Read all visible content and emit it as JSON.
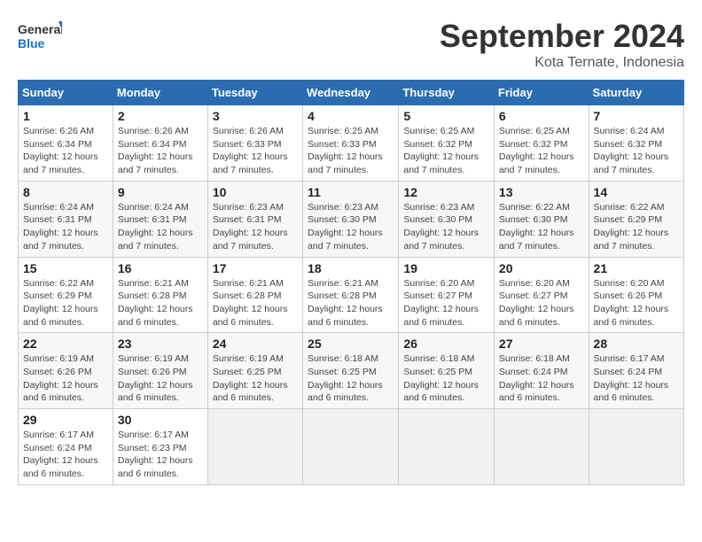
{
  "logo": {
    "line1": "General",
    "line2": "Blue"
  },
  "title": "September 2024",
  "subtitle": "Kota Ternate, Indonesia",
  "days_header": [
    "Sunday",
    "Monday",
    "Tuesday",
    "Wednesday",
    "Thursday",
    "Friday",
    "Saturday"
  ],
  "weeks": [
    [
      {
        "day": "1",
        "sunrise": "6:26 AM",
        "sunset": "6:34 PM",
        "daylight": "12 hours and 7 minutes."
      },
      {
        "day": "2",
        "sunrise": "6:26 AM",
        "sunset": "6:34 PM",
        "daylight": "12 hours and 7 minutes."
      },
      {
        "day": "3",
        "sunrise": "6:26 AM",
        "sunset": "6:33 PM",
        "daylight": "12 hours and 7 minutes."
      },
      {
        "day": "4",
        "sunrise": "6:25 AM",
        "sunset": "6:33 PM",
        "daylight": "12 hours and 7 minutes."
      },
      {
        "day": "5",
        "sunrise": "6:25 AM",
        "sunset": "6:32 PM",
        "daylight": "12 hours and 7 minutes."
      },
      {
        "day": "6",
        "sunrise": "6:25 AM",
        "sunset": "6:32 PM",
        "daylight": "12 hours and 7 minutes."
      },
      {
        "day": "7",
        "sunrise": "6:24 AM",
        "sunset": "6:32 PM",
        "daylight": "12 hours and 7 minutes."
      }
    ],
    [
      {
        "day": "8",
        "sunrise": "6:24 AM",
        "sunset": "6:31 PM",
        "daylight": "12 hours and 7 minutes."
      },
      {
        "day": "9",
        "sunrise": "6:24 AM",
        "sunset": "6:31 PM",
        "daylight": "12 hours and 7 minutes."
      },
      {
        "day": "10",
        "sunrise": "6:23 AM",
        "sunset": "6:31 PM",
        "daylight": "12 hours and 7 minutes."
      },
      {
        "day": "11",
        "sunrise": "6:23 AM",
        "sunset": "6:30 PM",
        "daylight": "12 hours and 7 minutes."
      },
      {
        "day": "12",
        "sunrise": "6:23 AM",
        "sunset": "6:30 PM",
        "daylight": "12 hours and 7 minutes."
      },
      {
        "day": "13",
        "sunrise": "6:22 AM",
        "sunset": "6:30 PM",
        "daylight": "12 hours and 7 minutes."
      },
      {
        "day": "14",
        "sunrise": "6:22 AM",
        "sunset": "6:29 PM",
        "daylight": "12 hours and 7 minutes."
      }
    ],
    [
      {
        "day": "15",
        "sunrise": "6:22 AM",
        "sunset": "6:29 PM",
        "daylight": "12 hours and 6 minutes."
      },
      {
        "day": "16",
        "sunrise": "6:21 AM",
        "sunset": "6:28 PM",
        "daylight": "12 hours and 6 minutes."
      },
      {
        "day": "17",
        "sunrise": "6:21 AM",
        "sunset": "6:28 PM",
        "daylight": "12 hours and 6 minutes."
      },
      {
        "day": "18",
        "sunrise": "6:21 AM",
        "sunset": "6:28 PM",
        "daylight": "12 hours and 6 minutes."
      },
      {
        "day": "19",
        "sunrise": "6:20 AM",
        "sunset": "6:27 PM",
        "daylight": "12 hours and 6 minutes."
      },
      {
        "day": "20",
        "sunrise": "6:20 AM",
        "sunset": "6:27 PM",
        "daylight": "12 hours and 6 minutes."
      },
      {
        "day": "21",
        "sunrise": "6:20 AM",
        "sunset": "6:26 PM",
        "daylight": "12 hours and 6 minutes."
      }
    ],
    [
      {
        "day": "22",
        "sunrise": "6:19 AM",
        "sunset": "6:26 PM",
        "daylight": "12 hours and 6 minutes."
      },
      {
        "day": "23",
        "sunrise": "6:19 AM",
        "sunset": "6:26 PM",
        "daylight": "12 hours and 6 minutes."
      },
      {
        "day": "24",
        "sunrise": "6:19 AM",
        "sunset": "6:25 PM",
        "daylight": "12 hours and 6 minutes."
      },
      {
        "day": "25",
        "sunrise": "6:18 AM",
        "sunset": "6:25 PM",
        "daylight": "12 hours and 6 minutes."
      },
      {
        "day": "26",
        "sunrise": "6:18 AM",
        "sunset": "6:25 PM",
        "daylight": "12 hours and 6 minutes."
      },
      {
        "day": "27",
        "sunrise": "6:18 AM",
        "sunset": "6:24 PM",
        "daylight": "12 hours and 6 minutes."
      },
      {
        "day": "28",
        "sunrise": "6:17 AM",
        "sunset": "6:24 PM",
        "daylight": "12 hours and 6 minutes."
      }
    ],
    [
      {
        "day": "29",
        "sunrise": "6:17 AM",
        "sunset": "6:24 PM",
        "daylight": "12 hours and 6 minutes."
      },
      {
        "day": "30",
        "sunrise": "6:17 AM",
        "sunset": "6:23 PM",
        "daylight": "12 hours and 6 minutes."
      },
      null,
      null,
      null,
      null,
      null
    ]
  ]
}
